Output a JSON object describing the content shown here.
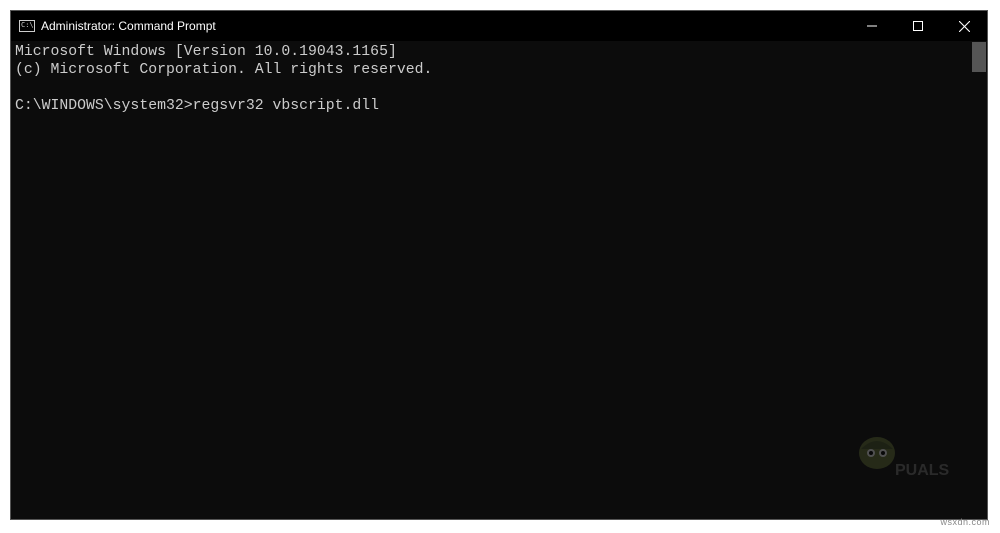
{
  "window": {
    "title": "Administrator: Command Prompt",
    "icon_label": "cmd-icon"
  },
  "terminal": {
    "line1": "Microsoft Windows [Version 10.0.19043.1165]",
    "line2": "(c) Microsoft Corporation. All rights reserved.",
    "blank": "",
    "prompt_line": "C:\\WINDOWS\\system32>regsvr32 vbscript.dll"
  },
  "watermark": {
    "text": "wsxdn.com"
  }
}
